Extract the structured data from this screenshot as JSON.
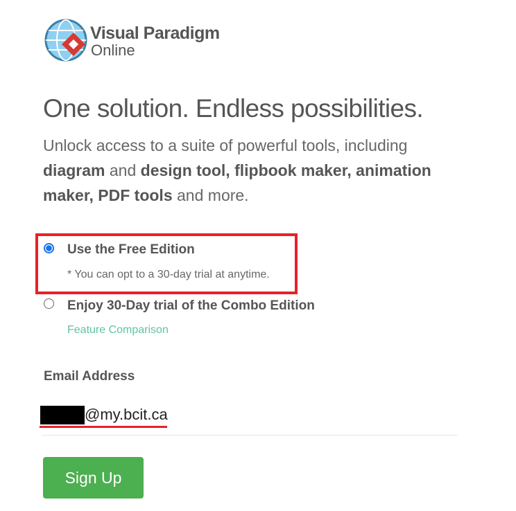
{
  "logo": {
    "line1": "Visual Paradigm",
    "line2": "Online"
  },
  "headline": "One solution. Endless possibilities.",
  "intro": {
    "t1": "Unlock access to a suite of powerful tools, including ",
    "b1": "diagram",
    "t2": " and ",
    "b2": "design tool, flipbook maker, animation maker, PDF tools",
    "t3": " and more."
  },
  "options": [
    {
      "label": "Use the Free Edition",
      "note": "* You can opt to a 30-day trial at anytime.",
      "selected": true
    },
    {
      "label": "Enjoy 30-Day trial of the Combo Edition",
      "link": "Feature Comparison",
      "selected": false
    }
  ],
  "email": {
    "label": "Email Address",
    "value": "@my.bcit.ca"
  },
  "signup_label": "Sign Up",
  "colors": {
    "accent": "#4caf50",
    "link": "#5fc3a2",
    "annotation": "#e8202a",
    "radio": "#1a73e8"
  }
}
